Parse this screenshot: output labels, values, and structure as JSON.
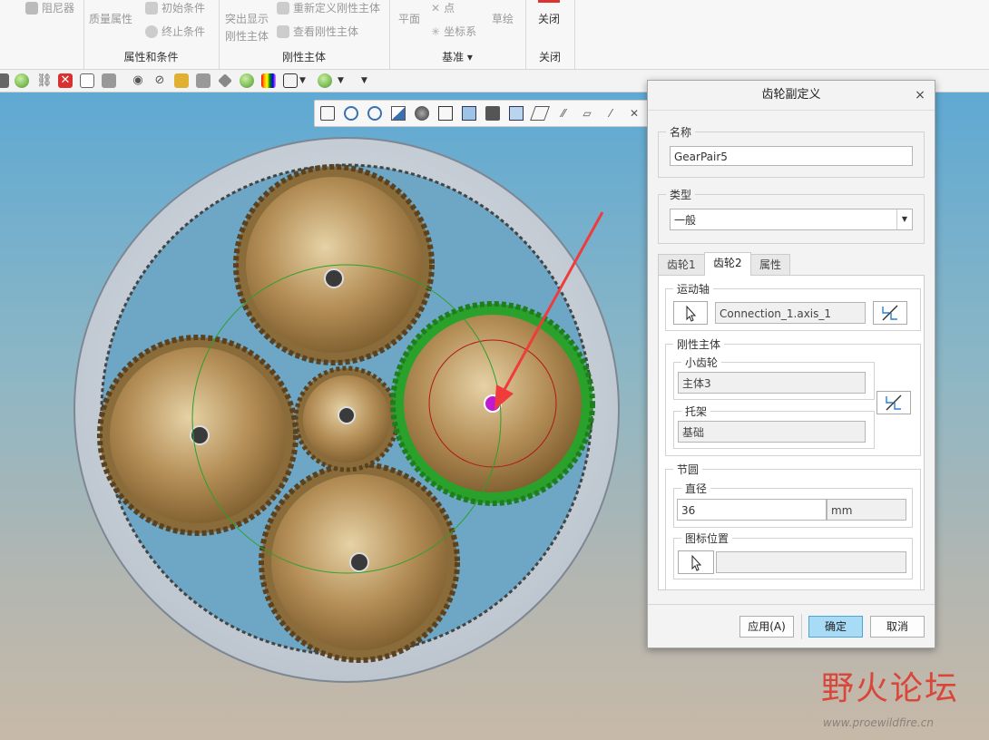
{
  "ribbon": {
    "groups": [
      {
        "label": "属性和条件",
        "items": [
          "阻尼器",
          "质量属性",
          "初始条件",
          "终止条件"
        ]
      },
      {
        "label": "刚性主体",
        "items": [
          "突出显示刚性主体",
          "重新定义刚性主体",
          "查看刚性主体"
        ]
      },
      {
        "label": "基准",
        "items": [
          "平面",
          "点",
          "坐标系",
          "草绘"
        ]
      },
      {
        "label": "关闭",
        "items": [
          "关闭"
        ]
      }
    ],
    "highlight_line1": "突出显示",
    "highlight_line2": "刚性主体",
    "datum_dropdown": "▾"
  },
  "dialog": {
    "title": "齿轮副定义",
    "close_glyph": "×",
    "name_legend": "名称",
    "name_value": "GearPair5",
    "type_legend": "类型",
    "type_value": "一般",
    "tabs": [
      {
        "label": "齿轮1",
        "active": false
      },
      {
        "label": "齿轮2",
        "active": true
      },
      {
        "label": "属性",
        "active": false
      }
    ],
    "motion_axis_legend": "运动轴",
    "motion_axis_value": "Connection_1.axis_1",
    "rigid_body_legend": "刚性主体",
    "pinion_legend": "小齿轮",
    "pinion_value": "主体3",
    "carrier_legend": "托架",
    "carrier_value": "基础",
    "pitch_circle_legend": "节圆",
    "diameter_legend": "直径",
    "diameter_value": "36",
    "diameter_unit": "mm",
    "icon_position_legend": "图标位置",
    "icon_position_value": "",
    "apply_label": "应用(A)",
    "ok_label": "确定",
    "cancel_label": "取消"
  },
  "watermark": {
    "text": "野火论坛",
    "url": "www.proewildfire.cn"
  },
  "colors": {
    "viewport_top": "#5fa9d3",
    "viewport_bottom": "#c7b9a8",
    "gear_bronze": "#b38d55",
    "ring_gear": "#c9d1da",
    "selection_green": "#2aa12a",
    "arrow_red": "#ef3b3b",
    "ok_button": "#a7dbf6"
  }
}
